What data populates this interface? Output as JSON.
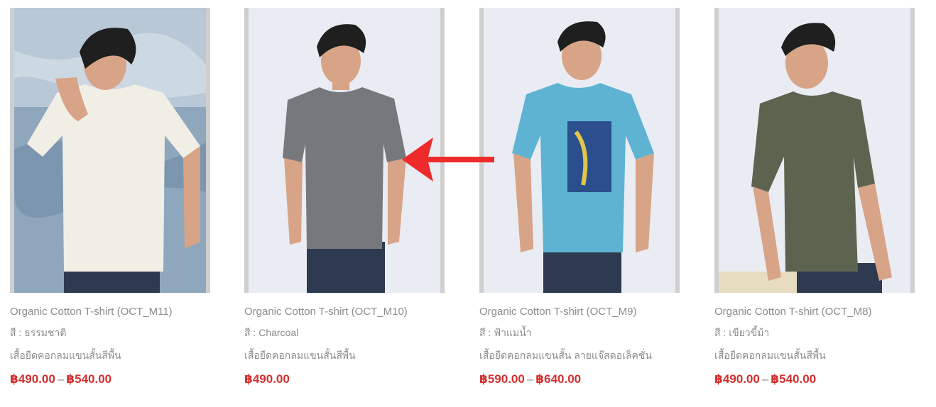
{
  "products": [
    {
      "title": "Organic Cotton T-shirt (OCT_M11)",
      "color": "สี : ธรรมชาติ",
      "description": "เสื้อยืดคอกลมแขนสั้นสีพื้น",
      "price_min": "฿490.00",
      "price_sep": "–",
      "price_max": "฿540.00",
      "shirt_color": "#f1eee6",
      "background_color": "#8fa7bd"
    },
    {
      "title": "Organic Cotton T-shirt (OCT_M10)",
      "color": "สี : Charcoal",
      "description": "เสื้อยืดคอกลมแขนสั้นสีพื้น",
      "price_min": "฿490.00",
      "price_sep": "",
      "price_max": "",
      "shirt_color": "#77787c",
      "background_color": "#e9ecf3"
    },
    {
      "title": "Organic Cotton T-shirt (OCT_M9)",
      "color": "สี : ฟ้าแมน้ำ",
      "description": "เสื้อยืดคอกลมแขนสั้น ลายแจ๊สดอเล็คชั่น",
      "price_min": "฿590.00",
      "price_sep": "–",
      "price_max": "฿640.00",
      "shirt_color": "#5fb3d2",
      "background_color": "#e9ecf3"
    },
    {
      "title": "Organic Cotton T-shirt (OCT_M8)",
      "color": "สี : เขียวขี้ม้า",
      "description": "เสื้อยืดคอกลมแขนสั้นสีพื้น",
      "price_min": "฿490.00",
      "price_sep": "–",
      "price_max": "฿540.00",
      "shirt_color": "#5c6450",
      "background_color": "#e9ecf3"
    }
  ],
  "colors": {
    "price": "#d32f2f",
    "text": "#8c8c8c",
    "arrow": "#ee2a2a",
    "frame": "#cfcfcf"
  }
}
